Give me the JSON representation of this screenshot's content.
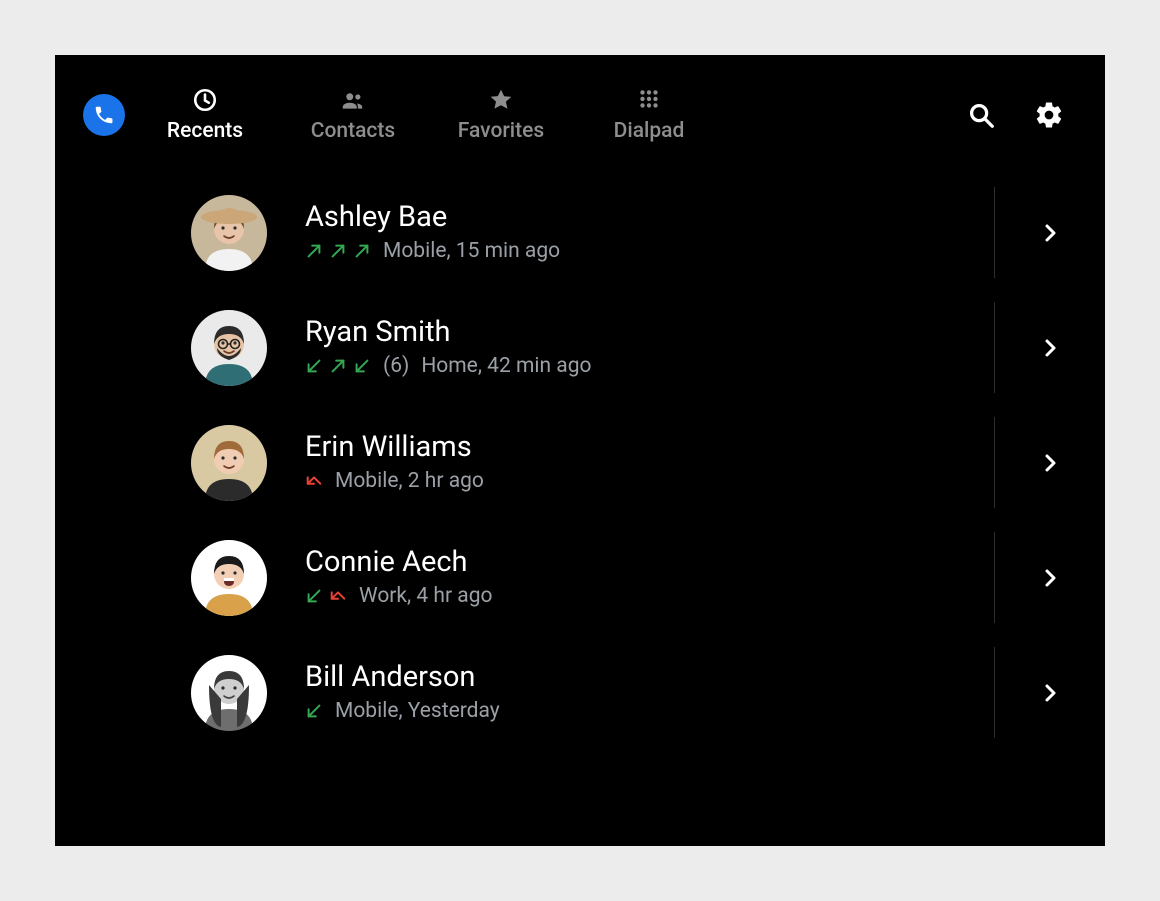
{
  "colors": {
    "accent": "#1a73e8",
    "outgoing": "#34a853",
    "incoming": "#34a853",
    "missed": "#ea4335",
    "inactive": "#8e8e8e",
    "text_secondary": "#9aa0a6"
  },
  "topbar": {
    "phone_button": "phone",
    "search_label": "Search",
    "settings_label": "Settings"
  },
  "tabs": [
    {
      "id": "recents",
      "label": "Recents",
      "icon": "clock-icon",
      "active": true
    },
    {
      "id": "contacts",
      "label": "Contacts",
      "icon": "people-icon",
      "active": false
    },
    {
      "id": "favorites",
      "label": "Favorites",
      "icon": "star-icon",
      "active": false
    },
    {
      "id": "dialpad",
      "label": "Dialpad",
      "icon": "dialpad-icon",
      "active": false
    }
  ],
  "recents": [
    {
      "name": "Ashley Bae",
      "avatar": "ashley",
      "directions": [
        "outgoing",
        "outgoing",
        "outgoing"
      ],
      "count_label": "",
      "detail": "Mobile, 15 min ago"
    },
    {
      "name": "Ryan Smith",
      "avatar": "ryan",
      "directions": [
        "incoming",
        "outgoing",
        "incoming"
      ],
      "count_label": "(6)",
      "detail": "Home, 42 min ago"
    },
    {
      "name": "Erin Williams",
      "avatar": "erin",
      "directions": [
        "missed"
      ],
      "count_label": "",
      "detail": "Mobile, 2 hr ago"
    },
    {
      "name": "Connie Aech",
      "avatar": "connie",
      "directions": [
        "incoming",
        "missed"
      ],
      "count_label": "",
      "detail": "Work, 4 hr ago"
    },
    {
      "name": "Bill Anderson",
      "avatar": "bill",
      "directions": [
        "incoming"
      ],
      "count_label": "",
      "detail": "Mobile, Yesterday"
    }
  ]
}
